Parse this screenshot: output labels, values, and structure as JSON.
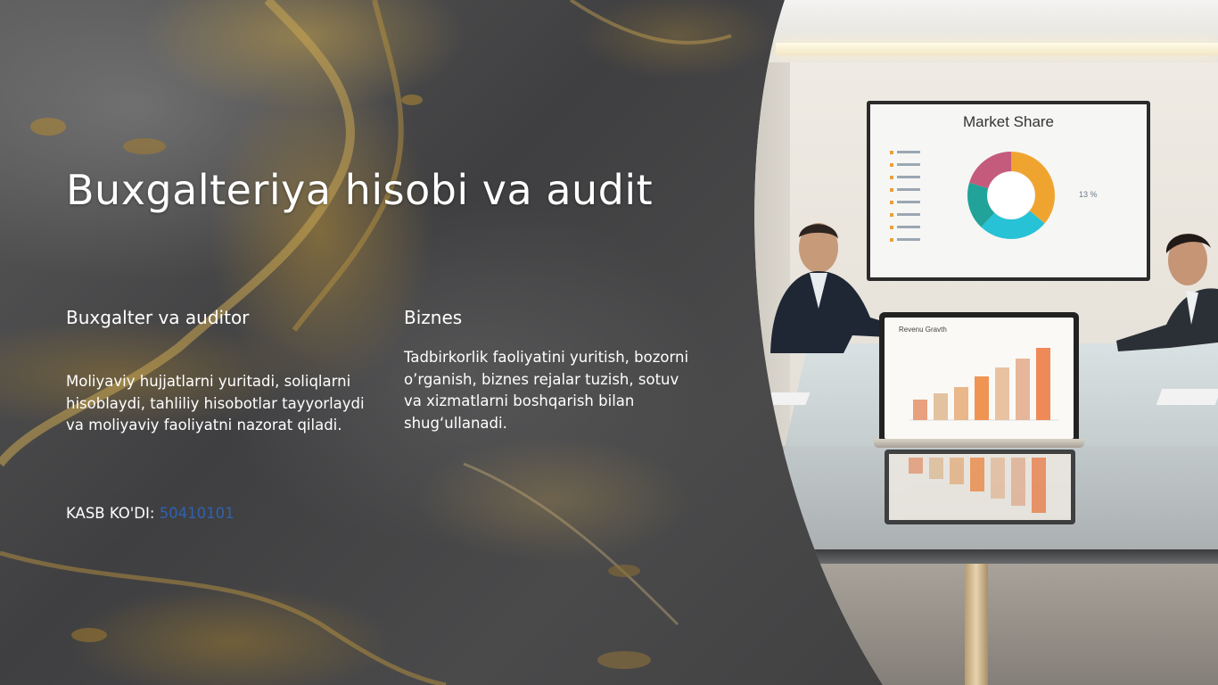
{
  "slide": {
    "title": "Buxgalteriya hisobi va audit",
    "columns": [
      {
        "heading": "Buxgalter va auditor",
        "text": "Moliyaviy hujjatlarni yuritadi, soliqlarni hisoblaydi, tahliliy hisobotlar tayyorlaydi va moliyaviy faoliyatni nazorat qiladi."
      },
      {
        "heading": "Biznes",
        "text": "Tadbirkorlik faoliyatini yuritish, bozorni o’rganish, biznes rejalar tuzish, sotuv va xizmatlarni boshqarish bilan shug‘ullanadi."
      }
    ],
    "code": {
      "label": "KASB KO'DI:",
      "value": "50410101"
    }
  },
  "photo": {
    "tv_title": "Market Share",
    "tv_side_label": "13 %",
    "laptop_title": "Revenu Gravth",
    "donut_colors": [
      "#f0a430",
      "#27c2d6",
      "#21a39a",
      "#c45a7c"
    ],
    "bar_colors": [
      "#e8a07e",
      "#e3c29f",
      "#e9b78a",
      "#f09454",
      "#e9c2a2",
      "#e7b69a",
      "#ef8a58"
    ]
  },
  "colors": {
    "code_value": "#2f62b0",
    "text": "#ffffff"
  }
}
